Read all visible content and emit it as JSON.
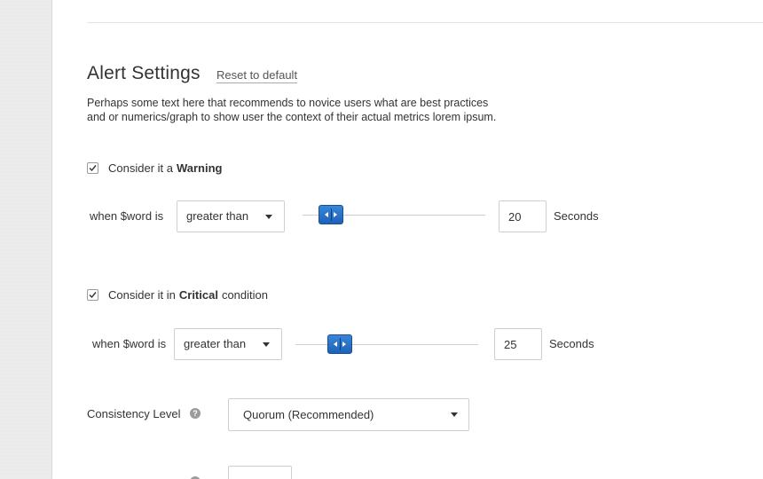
{
  "alert_settings": {
    "title": "Alert Settings",
    "reset_label": "Reset to default",
    "description_line1": "Perhaps some text here that recommends to novice users what are best practices",
    "description_line2": "and or numerics/graph to show user the context of their actual metrics lorem ipsum."
  },
  "warning": {
    "checked": true,
    "label_prefix": "Consider it a",
    "label_bold": "Warning",
    "label_suffix": "",
    "condition_label": "when $word is",
    "operator": "greater than",
    "slider_value": 0.1,
    "value": "20",
    "unit": "Seconds"
  },
  "critical": {
    "checked": true,
    "label_prefix": "Consider it in",
    "label_bold": "Critical",
    "label_suffix": "condition",
    "condition_label": "when $word is",
    "operator": "greater than",
    "slider_value": 0.2,
    "value": "25",
    "unit": "Seconds"
  },
  "consistency": {
    "label": "Consistency Level",
    "help_icon": "question-circle-icon",
    "selected": "Quorum (Recommended)"
  },
  "icons": {
    "checkbox": "check-icon",
    "dropdown": "caret-down-icon",
    "slider_handle": "slider-handle-icon"
  },
  "colors": {
    "accent": "#2a74c9",
    "panel_background": "#ffffff",
    "gutter_background": "#ececec"
  }
}
